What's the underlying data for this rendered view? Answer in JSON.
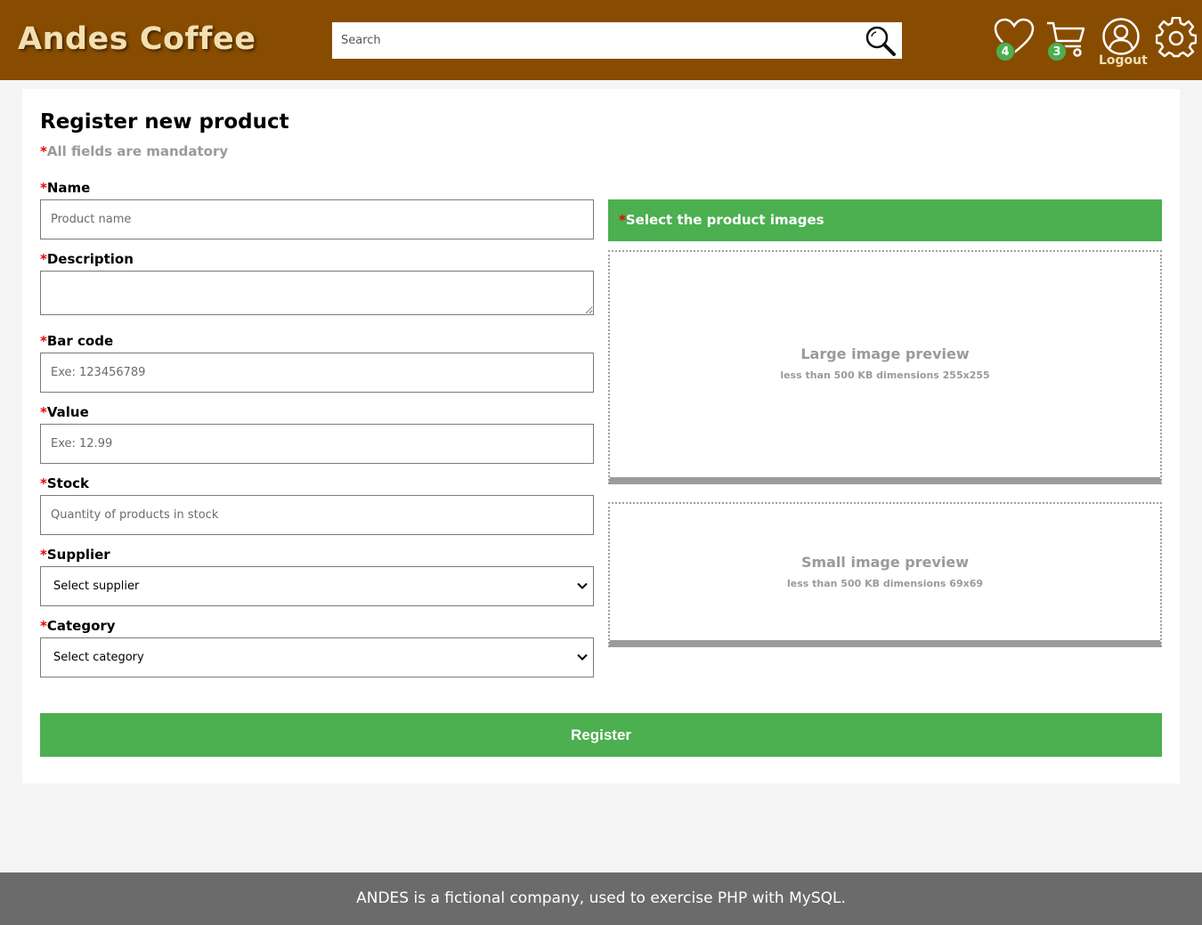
{
  "header": {
    "logo": "Andes Coffee",
    "search_placeholder": "Search",
    "favorites_count": "4",
    "cart_count": "3",
    "logout_label": "Logout"
  },
  "form": {
    "title": "Register new product",
    "required_mark": "*",
    "mandatory_note": "All fields are mandatory",
    "fields": {
      "name": {
        "label": "Name",
        "placeholder": "Product name"
      },
      "description": {
        "label": "Description",
        "placeholder": ""
      },
      "barcode": {
        "label": "Bar code",
        "placeholder": "Exe: 123456789"
      },
      "value": {
        "label": "Value",
        "placeholder": "Exe: 12.99"
      },
      "stock": {
        "label": "Stock",
        "placeholder": "Quantity of products in stock"
      },
      "supplier": {
        "label": "Supplier",
        "selected": "Select supplier"
      },
      "category": {
        "label": "Category",
        "selected": "Select category"
      }
    },
    "images": {
      "header": "Select the product images",
      "large_title": "Large image preview",
      "large_hint": "less than 500 KB dimensions 255x255",
      "small_title": "Small image preview",
      "small_hint": "less than 500 KB dimensions 69x69"
    },
    "submit_label": "Register"
  },
  "footer": {
    "text": "ANDES is a fictional company, used to exercise PHP with MySQL."
  },
  "colors": {
    "header_bg": "#874c00",
    "logo": "#f3dfb0",
    "accent_green": "#4caf50",
    "required_red": "#e00000",
    "footer_bg": "#6b6b6b"
  },
  "icons": [
    "search-icon",
    "heart-icon",
    "cart-icon",
    "user-icon",
    "gear-icon",
    "chevron-down-icon"
  ]
}
